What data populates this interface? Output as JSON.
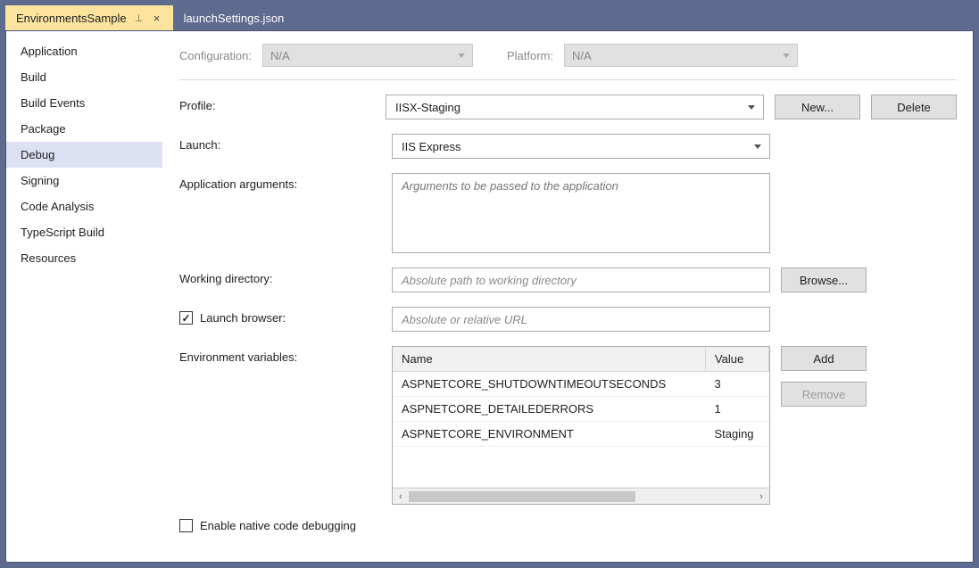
{
  "tabs": [
    {
      "label": "EnvironmentsSample",
      "active": true,
      "pinned": true
    },
    {
      "label": "launchSettings.json",
      "active": false
    }
  ],
  "sidebar": {
    "items": [
      "Application",
      "Build",
      "Build Events",
      "Package",
      "Debug",
      "Signing",
      "Code Analysis",
      "TypeScript Build",
      "Resources"
    ],
    "selectedIndex": 4
  },
  "top": {
    "configLabel": "Configuration:",
    "configValue": "N/A",
    "platformLabel": "Platform:",
    "platformValue": "N/A"
  },
  "form": {
    "profileLabel": "Profile:",
    "profileValue": "IISX-Staging",
    "newLabel": "New...",
    "deleteLabel": "Delete",
    "launchLabel": "Launch:",
    "launchValue": "IIS Express",
    "appArgsLabel": "Application arguments:",
    "appArgsPlaceholder": "Arguments to be passed to the application",
    "workingDirLabel": "Working directory:",
    "workingDirPlaceholder": "Absolute path to working directory",
    "browseLabel": "Browse...",
    "launchBrowserLabel": "Launch browser:",
    "launchBrowserChecked": true,
    "launchBrowserPlaceholder": "Absolute or relative URL",
    "envVarsLabel": "Environment variables:",
    "envHeaders": {
      "name": "Name",
      "value": "Value"
    },
    "envRows": [
      {
        "name": "ASPNETCORE_SHUTDOWNTIMEOUTSECONDS",
        "value": "3"
      },
      {
        "name": "ASPNETCORE_DETAILEDERRORS",
        "value": "1"
      },
      {
        "name": "ASPNETCORE_ENVIRONMENT",
        "value": "Staging"
      }
    ],
    "addLabel": "Add",
    "removeLabel": "Remove",
    "nativeDebugLabel": "Enable native code debugging",
    "nativeDebugChecked": false
  }
}
